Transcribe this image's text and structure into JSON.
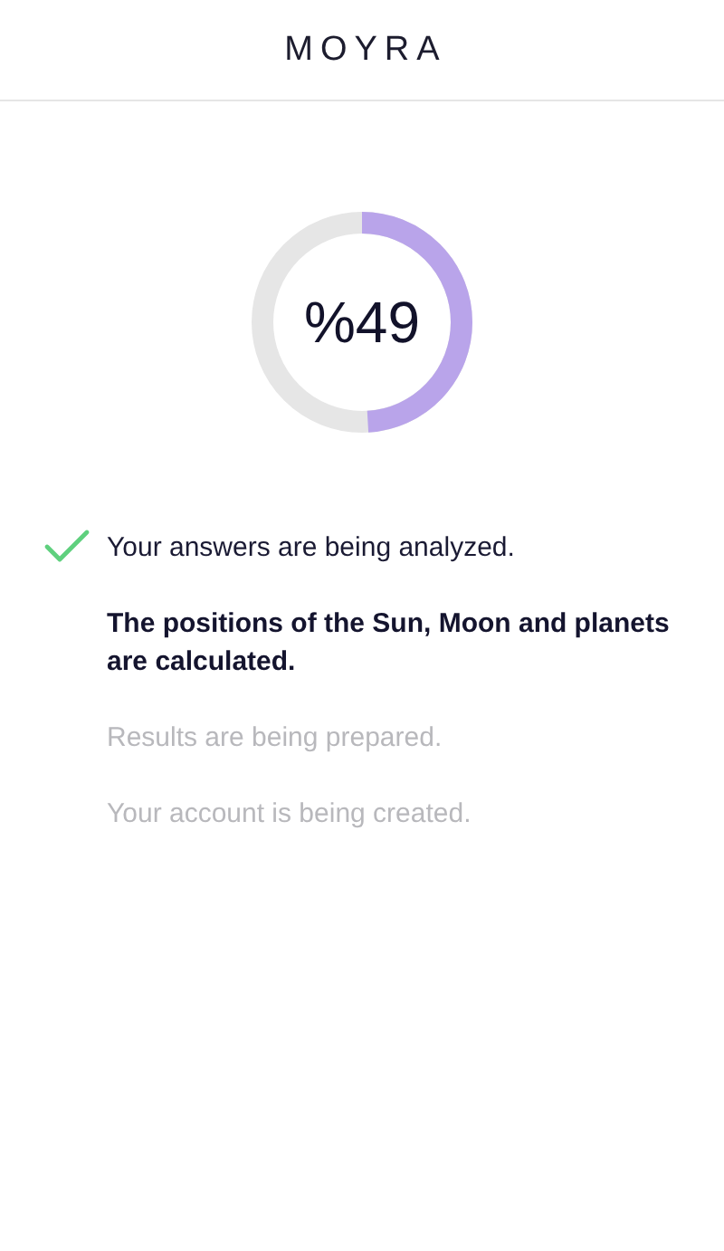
{
  "header": {
    "logo": "MOYRA"
  },
  "progress": {
    "label": "%49",
    "level": 0.49
  },
  "steps": [
    {
      "text": "Your answers are being analyzed.",
      "kind": "done"
    },
    {
      "text": "The positions of the Sun, Moon and planets are calculated.",
      "kind": "active"
    },
    {
      "text": "Results are being prepared.",
      "kind": "pending"
    },
    {
      "text": "Your account is being created.",
      "kind": "pending"
    }
  ]
}
